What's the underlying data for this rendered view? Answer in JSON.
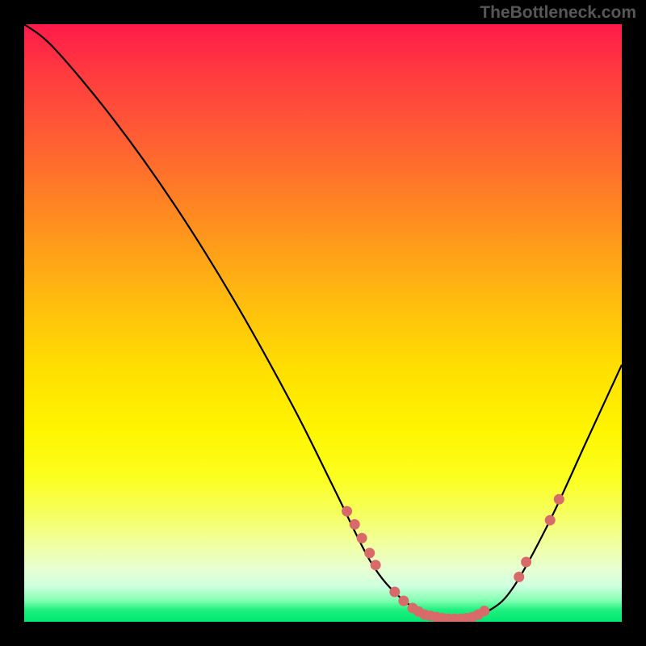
{
  "watermark": "TheBottleneck.com",
  "chart_data": {
    "type": "line",
    "title": "",
    "xlabel": "",
    "ylabel": "",
    "xlim": [
      0,
      100
    ],
    "ylim": [
      0,
      100
    ],
    "curve": [
      {
        "x": 0,
        "y": 100
      },
      {
        "x": 5,
        "y": 96
      },
      {
        "x": 15,
        "y": 84
      },
      {
        "x": 25,
        "y": 70
      },
      {
        "x": 35,
        "y": 54
      },
      {
        "x": 45,
        "y": 36
      },
      {
        "x": 52,
        "y": 22
      },
      {
        "x": 58,
        "y": 10
      },
      {
        "x": 63,
        "y": 4
      },
      {
        "x": 68,
        "y": 1
      },
      {
        "x": 73,
        "y": 0.5
      },
      {
        "x": 78,
        "y": 2
      },
      {
        "x": 82,
        "y": 6
      },
      {
        "x": 88,
        "y": 17
      },
      {
        "x": 94,
        "y": 30
      },
      {
        "x": 100,
        "y": 43
      }
    ],
    "highlight_points": [
      {
        "x": 54.0,
        "y": 18.5
      },
      {
        "x": 55.3,
        "y": 16.3
      },
      {
        "x": 56.5,
        "y": 14.0
      },
      {
        "x": 57.8,
        "y": 11.5
      },
      {
        "x": 58.8,
        "y": 9.5
      },
      {
        "x": 62.0,
        "y": 5.0
      },
      {
        "x": 63.5,
        "y": 3.5
      },
      {
        "x": 65.0,
        "y": 2.3
      },
      {
        "x": 66.0,
        "y": 1.7
      },
      {
        "x": 67.0,
        "y": 1.2
      },
      {
        "x": 68.0,
        "y": 1.0
      },
      {
        "x": 69.0,
        "y": 0.8
      },
      {
        "x": 70.0,
        "y": 0.6
      },
      {
        "x": 71.0,
        "y": 0.5
      },
      {
        "x": 72.0,
        "y": 0.5
      },
      {
        "x": 73.0,
        "y": 0.5
      },
      {
        "x": 74.0,
        "y": 0.6
      },
      {
        "x": 75.0,
        "y": 0.8
      },
      {
        "x": 76.0,
        "y": 1.2
      },
      {
        "x": 77.0,
        "y": 1.8
      },
      {
        "x": 82.8,
        "y": 7.5
      },
      {
        "x": 84.0,
        "y": 10.0
      },
      {
        "x": 88.0,
        "y": 17.0
      },
      {
        "x": 89.5,
        "y": 20.5
      }
    ],
    "colors": {
      "curve_stroke": "#000000",
      "point_fill": "#d96a6a",
      "gradient_top": "#ff1a4a",
      "gradient_bottom": "#00e870"
    }
  }
}
